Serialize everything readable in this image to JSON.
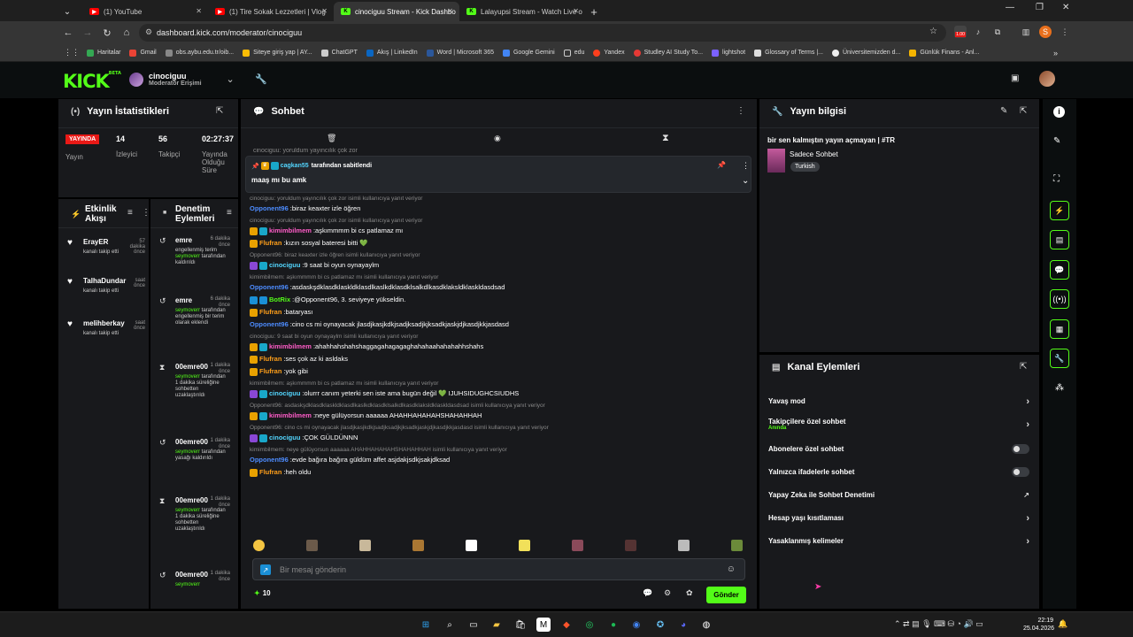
{
  "browser": {
    "tabs": [
      {
        "title": "(1) YouTube",
        "icon": "youtube-icon",
        "active": false
      },
      {
        "title": "(1) Tire Sokak Lezzetleri | Vlog",
        "icon": "youtube-icon",
        "active": false
      },
      {
        "title": "cinociguu Stream - Kick Dashbo",
        "icon": "kick-icon",
        "active": true
      },
      {
        "title": "Lalayupsi Stream - Watch Live o",
        "icon": "kick-icon",
        "active": false
      }
    ],
    "url": "dashboard.kick.com/moderator/cinociguu",
    "ext_badge": "1.00",
    "bookmarks": [
      "Haritalar",
      "Gmail",
      "obs.aybu.edu.tr/oib...",
      "Siteye giriş yap | AY...",
      "ChatGPT",
      "Akış | LinkedIn",
      "Word | Microsoft 365",
      "Google Gemini",
      "edu",
      "Yandex",
      "Studley AI Study To...",
      "lightshot",
      "Glossary of Terms |...",
      "Üniversitemizden d...",
      "Günlük Finans - Anl..."
    ]
  },
  "kick": {
    "logo": "KICK",
    "logo_beta": "BETA",
    "channel_name": "cinociguu",
    "role": "Moderatör Erişimi"
  },
  "stats": {
    "title": "Yayın İstatistikleri",
    "live_badge": "YAYINDA",
    "live_label": "Yayın",
    "viewers": "14",
    "viewers_label": "İzleyici",
    "followers": "56",
    "followers_label": "Takipçi",
    "uptime": "02:27:37",
    "uptime_label": "Yayında Olduğu Süre"
  },
  "activity": {
    "title": "Etkinlik Akışı",
    "items": [
      {
        "name": "ErayER",
        "time": "57 dakika önce",
        "desc": "kanalı takip etti"
      },
      {
        "name": "TalhaDundar",
        "time": "saat önce",
        "desc": "kanalı takip etti"
      },
      {
        "name": "melihberkay",
        "time": "saat önce",
        "desc": "kanalı takip etti"
      }
    ]
  },
  "moderation": {
    "title": "Denetim Eylemleri",
    "items": [
      {
        "name": "emre",
        "time": "6 dakika önce",
        "pre": "engellenmiş terim ",
        "user": "seymoverr",
        "post": " tarafından kaldırıldı"
      },
      {
        "name": "emre",
        "time": "6 dakika önce",
        "pre": "",
        "user": "seymoverr",
        "post": " tarafından engellenmiş bir terim olarak eklendi"
      },
      {
        "name": "00emre00",
        "time": "1 dakika önce",
        "pre": "",
        "user": "seymoverr",
        "post": " tarafından 1 dakika süreliğine sohbetten uzaklaştırıldı"
      },
      {
        "name": "00emre00",
        "time": "1 dakika önce",
        "pre": "",
        "user": "seymoverr",
        "post": " tarafından yasağı kaldırıldı"
      },
      {
        "name": "00emre00",
        "time": "1 dakika önce",
        "pre": "",
        "user": "seymoverr",
        "post": " tarafından 1 dakika süreliğine sohbetten uzaklaştırıldı"
      },
      {
        "name": "00emre00",
        "time": "1 dakika önce",
        "pre": "",
        "user": "seymoverr",
        "post": ""
      }
    ]
  },
  "chat": {
    "title": "Sohbet",
    "truncated_top": "cinociguu: yoruldum yayıncılık çok zor",
    "pinned": {
      "by_user": "cagkan55",
      "by_text": "tarafından sabitlendi",
      "message": "maaş mı bu amk"
    },
    "messages": [
      {
        "reply": "cinociguu: yoruldum yayıncılık çok zor isimli kullanıcıya yanıt veriyor",
        "user": "Opponent96",
        "color": "#4d8cff",
        "badges": [],
        "text": "biraz keaxter izle öğren"
      },
      {
        "reply": "cinociguu: yoruldum yayıncılık çok zor isimli kullanıcıya yanıt veriyor",
        "user": "kimimbilmem",
        "color": "#ff5cc8",
        "badges": [
          "b-crown",
          "b-sub"
        ],
        "text": "aşkımmmm bi cs patlamaz mı"
      },
      {
        "reply": "",
        "user": "Flufran",
        "color": "#ff9f1a",
        "badges": [
          "b-crown"
        ],
        "text": "kızın sosyal bateresi bitti 💚"
      },
      {
        "reply": "Opponent96: biraz keaxter izle öğren isimli kullanıcıya yanıt veriyor",
        "user": "cinociguu",
        "color": "#53d6ff",
        "badges": [
          "b-mic",
          "b-sub"
        ],
        "text": "9 saat bi oyun oynayaylm"
      },
      {
        "reply": "kimimbilmem: aşkımmmm bi cs patlamaz mı isimli kullanıcıya yanıt veriyor",
        "user": "Opponent96",
        "color": "#4d8cff",
        "badges": [],
        "text": "asdaskşdklasdklaskldklasdlkaslkdklasdklsalkdlkasdklaksldklaskldasdsad"
      },
      {
        "reply": "",
        "user": "BotRix",
        "color": "#53fc18",
        "badges": [
          "b-bot",
          "b-bot"
        ],
        "text": "@Opponent96, 3. seviyeye yükseldin."
      },
      {
        "reply": "",
        "user": "Flufran",
        "color": "#ff9f1a",
        "badges": [
          "b-crown"
        ],
        "text": "bataryası"
      },
      {
        "reply": "",
        "user": "Opponent96",
        "color": "#4d8cff",
        "badges": [],
        "text": "cino cs mi oynayacak jlasdjkasjkdkjsadjksadjkjksadkjaskjdjkasdjkkjasdasd"
      },
      {
        "reply": "cinociguu: 9 saat bi oyun oynayaylm isimli kullanıcıya yanıt veriyor",
        "user": "kimimbilmem",
        "color": "#ff5cc8",
        "badges": [
          "b-crown",
          "b-sub"
        ],
        "text": "ahahhahshahshaggagahagagaghahahaahahahahhshahs"
      },
      {
        "reply": "",
        "user": "Flufran",
        "color": "#ff9f1a",
        "badges": [
          "b-crown"
        ],
        "text": "ses çok az ki asldaks"
      },
      {
        "reply": "",
        "user": "Flufran",
        "color": "#ff9f1a",
        "badges": [
          "b-crown"
        ],
        "text": "yok gibi"
      },
      {
        "reply": "kimimbilmem: aşkımmmm bi cs patlamaz mı isimli kullanıcıya yanıt veriyor",
        "user": "cinociguu",
        "color": "#53d6ff",
        "badges": [
          "b-mic",
          "b-sub"
        ],
        "text": "olurrr canım yeterki sen iste ama bugün değil 💚 IJUHSIDUGHCSIUDHS"
      },
      {
        "reply": "Opponent96: asdaskşdklasdklaskldklasdlkaslkdklasdklsalkdlkasdklaksldklaskldasdsad isimli kullanıcıya yanıt veriyor",
        "user": "kimimbilmem",
        "color": "#ff5cc8",
        "badges": [
          "b-crown",
          "b-sub"
        ],
        "text": "neye gülüyorsun aaaaaa AHAHHAHAHAHSHAHAHHAH"
      },
      {
        "reply": "Opponent96: cino cs mi oynayacak jlasdjkasjkdkjsadjksadjkjksadkjaskjdjkasdjkkjasdasd isimli kullanıcıya yanıt veriyor",
        "user": "cinociguu",
        "color": "#53d6ff",
        "badges": [
          "b-mic",
          "b-sub"
        ],
        "text": "ÇOK GÜLDÜNNN"
      },
      {
        "reply": "kimimbilmem: neye gülüyorsun aaaaaa AHAHHAHAHAHSHAHAHHAH isimli kullanıcıya yanıt veriyor",
        "user": "Opponent96",
        "color": "#4d8cff",
        "badges": [],
        "text": "evde bağıra bağıra güldüm affet asjdakjsdkjsakjdksad"
      },
      {
        "reply": "",
        "user": "Flufran",
        "color": "#ff9f1a",
        "badges": [
          "b-crown"
        ],
        "text": "heh oldu"
      }
    ],
    "input_placeholder": "Bir mesaj gönderin",
    "points": "10",
    "send_label": "Gönder"
  },
  "stream_info": {
    "title": "Yayın bilgisi",
    "stream_title": "bir sen kalmıştın yayın açmayan | #TR",
    "category": "Sadece Sohbet",
    "tag": "Turkish"
  },
  "channel_actions": {
    "title": "Kanal Eylemleri",
    "items": [
      {
        "label": "Yavaş mod",
        "sub": "",
        "control": "arrow"
      },
      {
        "label": "Takipçilere özel sohbet",
        "sub": "Anında",
        "control": "arrow"
      },
      {
        "label": "Abonelere özel sohbet",
        "sub": "",
        "control": "toggle"
      },
      {
        "label": "Yalnızca ifadelerle sohbet",
        "sub": "",
        "control": "toggle"
      },
      {
        "label": "Yapay Zeka ile Sohbet Denetimi",
        "sub": "",
        "control": "external"
      },
      {
        "label": "Hesap yaşı kısıtlaması",
        "sub": "",
        "control": "arrow"
      },
      {
        "label": "Yasaklanmış kelimeler",
        "sub": "",
        "control": "arrow"
      }
    ]
  },
  "taskbar": {
    "time": "22:19",
    "date": "25.04.2026"
  },
  "colors": {
    "kick_green": "#53fc18",
    "panel_bg": "#18191c",
    "live_red": "#e91916"
  }
}
